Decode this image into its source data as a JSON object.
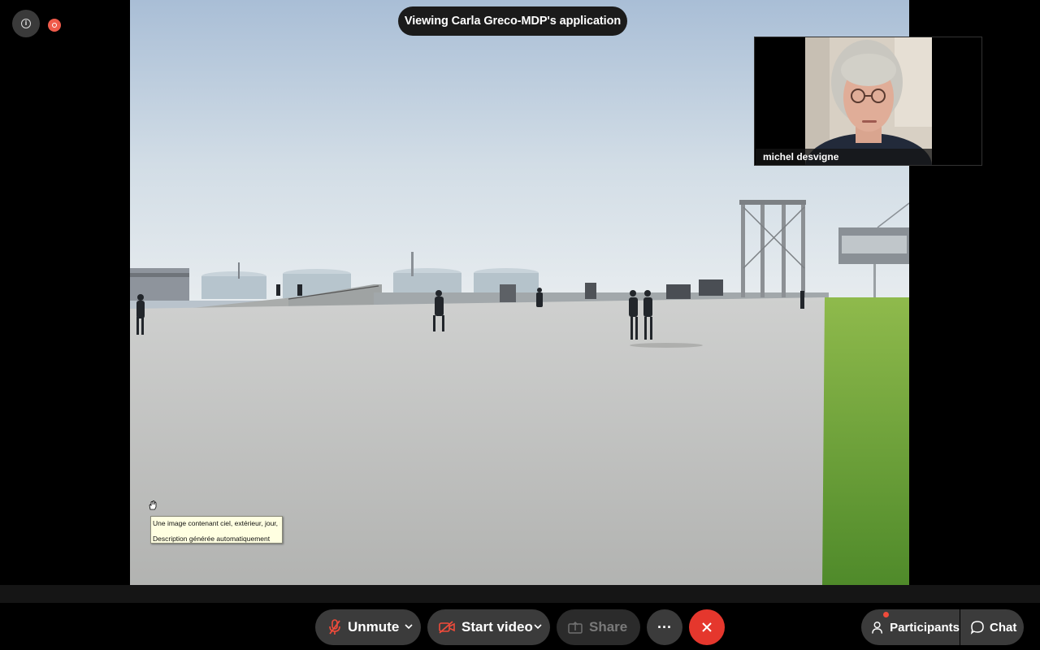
{
  "banner": {
    "text": "Viewing Carla Greco-MDP's application"
  },
  "video": {
    "participant_name": "michel desvigne"
  },
  "tooltip": {
    "line1": "Une image contenant ciel, extérieur, jour, rive",
    "line2": "Description générée automatiquement"
  },
  "top_controls": {
    "info_icon": "info-icon",
    "recording_icon": "recording-icon"
  },
  "toolbar": {
    "unmute_label": "Unmute",
    "start_video_label": "Start video",
    "share_label": "Share",
    "more_label": "···",
    "participants_label": "Participants",
    "chat_label": "Chat"
  },
  "colors": {
    "end_call": "#e5372d",
    "recording": "#ef5b4b",
    "button_bg": "#3b3b3b",
    "banner_bg": "#1b1b1b"
  }
}
